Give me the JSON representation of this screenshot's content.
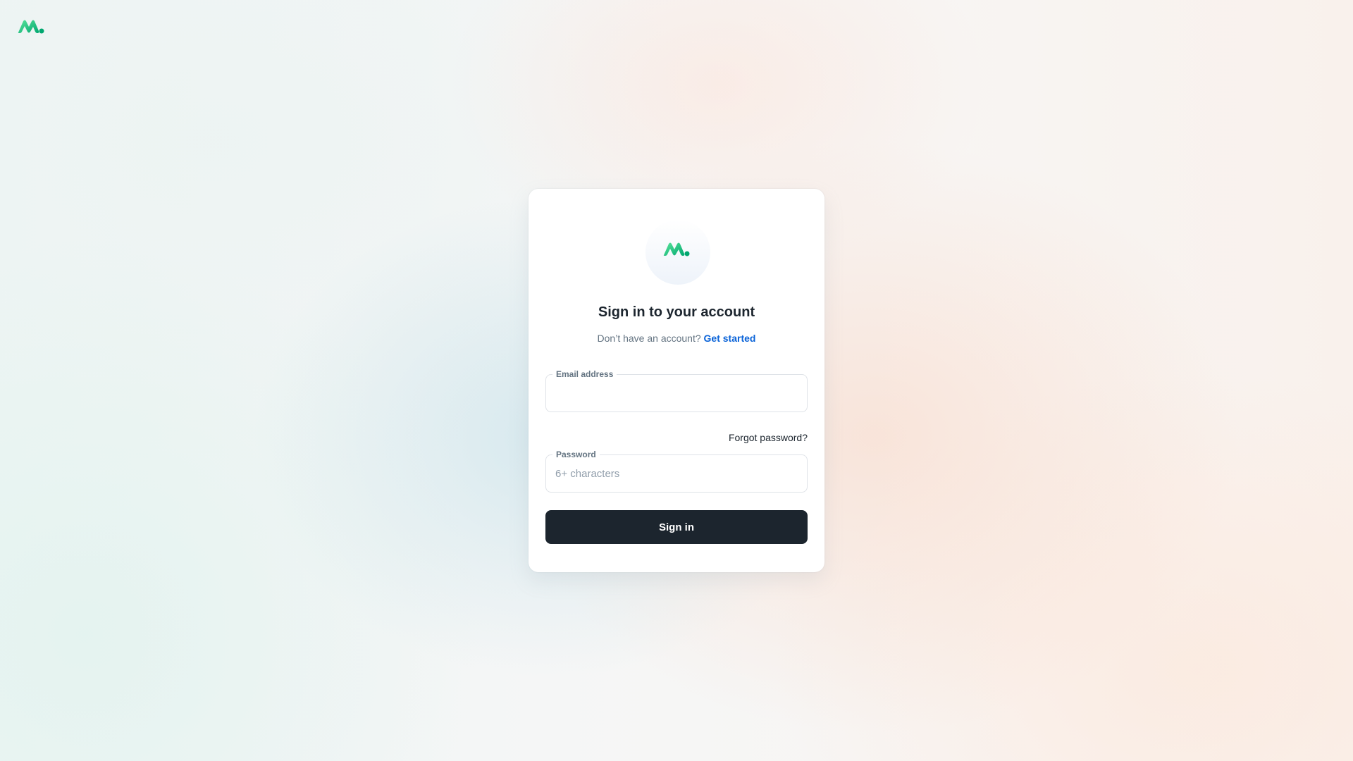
{
  "brand": {
    "logo_icon": "brand-logo-icon",
    "colors": {
      "green_dark": "#00a76f",
      "green_light": "#5be49b"
    }
  },
  "card": {
    "logo_icon": "brand-logo-icon",
    "title": "Sign in to your account",
    "subtitle": "Don’t have an account?",
    "signup_link": "Get started"
  },
  "form": {
    "email": {
      "label": "Email address",
      "value": "",
      "placeholder": ""
    },
    "forgot_password": "Forgot password?",
    "password": {
      "label": "Password",
      "value": "",
      "placeholder": "6+ characters"
    },
    "submit_label": "Sign in"
  },
  "colors": {
    "primary_button": "#1c252e",
    "link": "#0a63d8",
    "text_secondary": "#637381"
  }
}
